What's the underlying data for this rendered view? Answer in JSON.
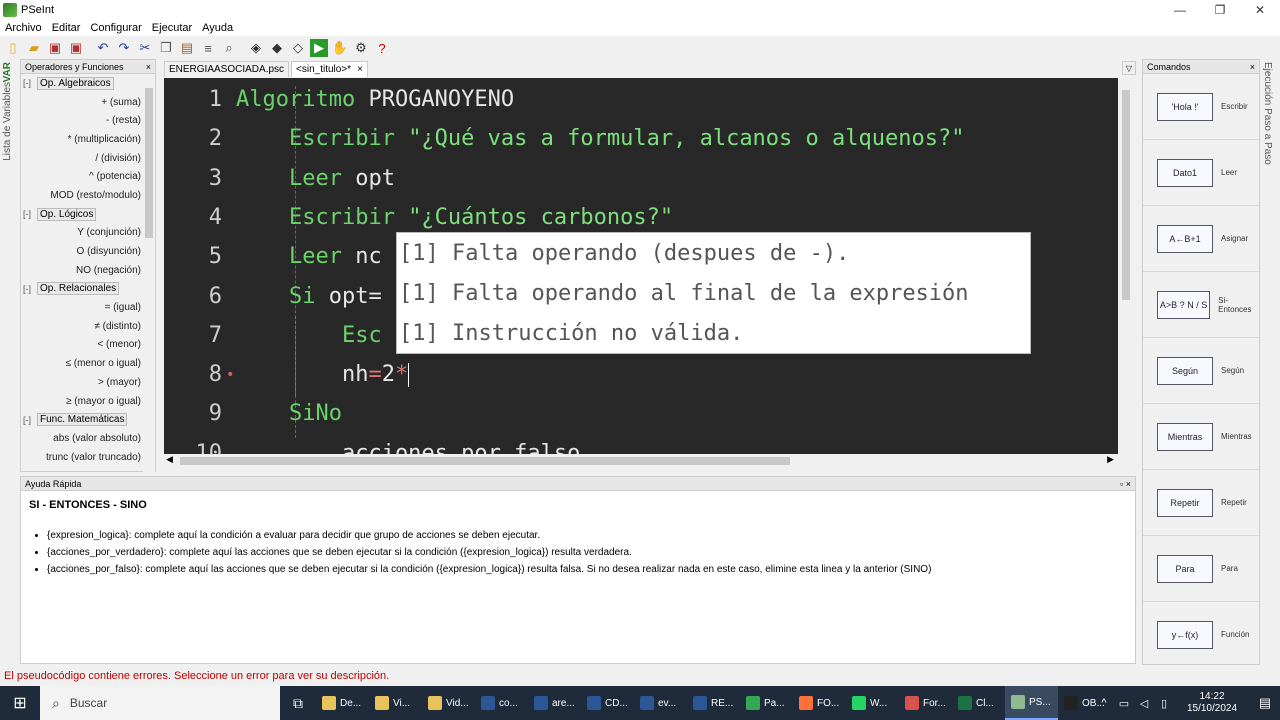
{
  "window": {
    "title": "PSeInt",
    "min": "—",
    "max": "❐",
    "close": "✕"
  },
  "menu": [
    "Archivo",
    "Editar",
    "Configurar",
    "Ejecutar",
    "Ayuda"
  ],
  "toolbar_icons": [
    "new-file-icon",
    "open-icon",
    "save-icon",
    "save-as-icon",
    "undo-icon",
    "redo-icon",
    "cut-icon",
    "copy-icon",
    "paste-icon",
    "indent-icon",
    "find-icon",
    "replace-icon",
    "diagram-icon",
    "step-icon",
    "run-icon",
    "pause-icon",
    "debug-icon",
    "help-icon"
  ],
  "left_vtab": {
    "text": "Lista de Variables",
    "colored": "VAR"
  },
  "ops_panel": {
    "title": "Operadores y Funciones",
    "close": "×",
    "groups": [
      {
        "name": "Op. Algebraicos",
        "toggle": "[-]",
        "items": [
          "+ (suma)",
          "- (resta)",
          "* (multiplicación)",
          "/ (división)",
          "^ (potencia)",
          "MOD (resto/modulo)"
        ]
      },
      {
        "name": "Op. Lógicos",
        "toggle": "[-]",
        "items": [
          "Y (conjunción)",
          "O (disyunción)",
          "NO (negación)"
        ]
      },
      {
        "name": "Op. Relacionales",
        "toggle": "[-]",
        "items": [
          "= (igual)",
          "≠ (distinto)",
          "< (menor)",
          "≤ (menor o igual)",
          "> (mayor)",
          "≥ (mayor o igual)"
        ]
      },
      {
        "name": "Func. Matemáticas",
        "toggle": "[-]",
        "items": [
          "abs (valor absoluto)",
          "trunc (valor truncado)"
        ]
      }
    ]
  },
  "tabs": [
    {
      "label": "ENERGIAASOCIADA.psc",
      "active": false
    },
    {
      "label": "<sin_titulo>*",
      "active": true,
      "close": "×"
    }
  ],
  "code_lines": [
    {
      "n": "1",
      "parts": [
        [
          "kw",
          "Algoritmo "
        ],
        [
          "code",
          "PROGANOYENO"
        ]
      ]
    },
    {
      "n": "2",
      "parts": [
        [
          "kw",
          "    Escribir "
        ],
        [
          "str",
          "\"¿Qué vas a formular, alcanos o alquenos?\""
        ]
      ]
    },
    {
      "n": "3",
      "parts": [
        [
          "kw",
          "    Leer "
        ],
        [
          "code",
          "opt"
        ]
      ]
    },
    {
      "n": "4",
      "parts": [
        [
          "kw",
          "    Escribir "
        ],
        [
          "str",
          "\"¿Cuántos carbonos?\""
        ]
      ]
    },
    {
      "n": "5",
      "parts": [
        [
          "kw",
          "    Leer "
        ],
        [
          "code",
          "nc"
        ]
      ]
    },
    {
      "n": "6",
      "parts": [
        [
          "kw",
          "    Si "
        ],
        [
          "code",
          "opt="
        ]
      ]
    },
    {
      "n": "7",
      "parts": [
        [
          "kw",
          "        Esc"
        ]
      ]
    },
    {
      "n": "8",
      "parts": [
        [
          "code",
          "        nh"
        ],
        [
          "op",
          "="
        ],
        [
          "code",
          "2"
        ],
        [
          "op",
          "*"
        ]
      ]
    },
    {
      "n": "9",
      "parts": [
        [
          "kw",
          "    SiNo"
        ]
      ]
    },
    {
      "n": "10",
      "parts": [
        [
          "code",
          "        acciones_por_falso"
        ]
      ]
    }
  ],
  "error_popup": [
    "[1] Falta operando (despues de -).",
    "[1] Falta operando al final de la expresión",
    "[1] Instrucción no válida."
  ],
  "commands_panel": {
    "title": "Comandos",
    "close": "×",
    "items": [
      {
        "shape": "'Hola !'",
        "label": "Escribir"
      },
      {
        "shape": "Dato1",
        "label": "Leer"
      },
      {
        "shape": "A←B+1",
        "label": "Asignar"
      },
      {
        "shape": "A>B ? N / S",
        "label": "Si-Entonces"
      },
      {
        "shape": "Según",
        "label": "Según"
      },
      {
        "shape": "Mientras",
        "label": "Mientras"
      },
      {
        "shape": "Repetir",
        "label": "Repetir"
      },
      {
        "shape": "Para",
        "label": "Para"
      },
      {
        "shape": "y←f(x)",
        "label": "Función"
      }
    ]
  },
  "right_vtab": "Ejecución Paso a Paso",
  "help": {
    "header": "Ayuda Rápida",
    "title": "SI - ENTONCES - SINO",
    "items": [
      "{expresion_logica}: complete aquí la condición a evaluar para decidir que grupo de acciones se deben ejecutar.",
      "{acciones_por_verdadero}: complete aquí las acciones que se deben ejecutar si la condición ({expresion_logica}) resulta verdadera.",
      "{acciones_por_falso}: complete aquí las acciones que se deben ejecutar si la condición ({expresion_logica}) resulta falsa. Si no desea realizar nada en este caso, elimine esta linea y la anterior (SINO)"
    ]
  },
  "status": "El pseudocódigo contiene errores. Seleccione un error para ver su descripción.",
  "taskbar": {
    "search": "Buscar",
    "apps": [
      {
        "label": "De...",
        "color": "#e8c25a"
      },
      {
        "label": "Vi...",
        "color": "#e8c25a"
      },
      {
        "label": "Vid...",
        "color": "#e8c25a"
      },
      {
        "label": "co...",
        "color": "#2b5797"
      },
      {
        "label": "are...",
        "color": "#2b5797"
      },
      {
        "label": "CD...",
        "color": "#2b5797"
      },
      {
        "label": "ev...",
        "color": "#2b5797"
      },
      {
        "label": "RE...",
        "color": "#2b5797"
      },
      {
        "label": "Pa...",
        "color": "#34a853"
      },
      {
        "label": "FO...",
        "color": "#ff7139"
      },
      {
        "label": "W...",
        "color": "#25d366"
      },
      {
        "label": "For...",
        "color": "#d9534f"
      },
      {
        "label": "Cl...",
        "color": "#1e7145"
      },
      {
        "label": "PS...",
        "color": "#8fbc8f",
        "active": true
      },
      {
        "label": "OB...",
        "color": "#222222"
      }
    ],
    "time": "14:22",
    "date": "15/10/2024"
  }
}
